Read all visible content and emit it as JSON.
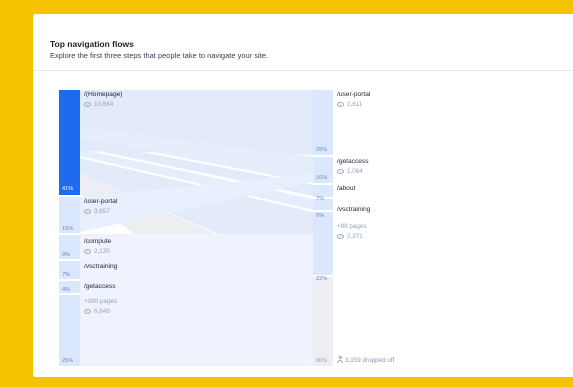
{
  "card": {
    "title": "Top navigation flows",
    "subtitle": "Explore the first three steps that people take to navigate your site."
  },
  "colors": {
    "brand_yellow": "#f5c200",
    "node_primary": "#1f6bf0",
    "node_light": "#dbe7fd",
    "node_lighter": "#e8effd",
    "link": "#e3ebfb",
    "dropped": "#eceef2"
  },
  "step1": {
    "nodes": [
      {
        "label": "/(Homepage)",
        "count": "10,664",
        "percent": "41%",
        "icon": "eye-icon",
        "selected": true
      },
      {
        "label": "/user-portal",
        "count": "3,657",
        "percent": "15%",
        "icon": "eye-icon"
      },
      {
        "label": "/compute",
        "count": "2,135",
        "percent": "9%",
        "icon": "eye-icon"
      },
      {
        "label": "/vsctraining",
        "count": "",
        "percent": "7%",
        "icon": "eye-icon"
      },
      {
        "label": "/getaccess",
        "count": "",
        "percent": "4%",
        "icon": "eye-icon"
      }
    ],
    "more": {
      "label": "+380 pages",
      "count": "6,649",
      "percent": "25%"
    }
  },
  "step2": {
    "nodes": [
      {
        "label": "/user-portal",
        "count": "2,611",
        "percent": "25%",
        "icon": "eye-icon"
      },
      {
        "label": "/getaccess",
        "count": "1,064",
        "percent": "10%",
        "icon": "eye-icon"
      },
      {
        "label": "/about",
        "count": "",
        "percent": "7%",
        "icon": "eye-icon"
      },
      {
        "label": "/vsctraining",
        "count": "",
        "percent": "6%",
        "icon": "eye-icon"
      }
    ],
    "more": {
      "label": "+88 pages",
      "count": "2,371",
      "percent": "22%"
    },
    "dropped": {
      "label": "3,159 dropped off",
      "percent": "30%",
      "icon": "person-icon"
    }
  }
}
